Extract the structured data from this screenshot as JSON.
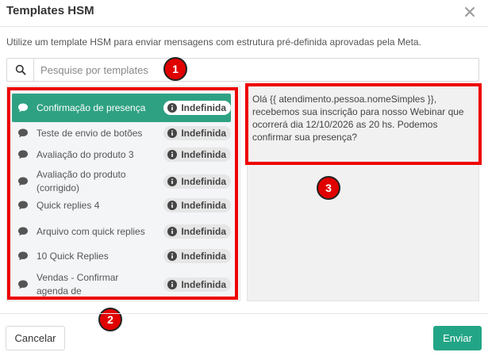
{
  "dialog": {
    "title": "Templates HSM",
    "description": "Utilize um template HSM para enviar mensagens com estrutura pré-definida aprovadas pela Meta."
  },
  "search": {
    "placeholder": "Pesquise por templates",
    "value": ""
  },
  "templates": [
    {
      "label": "Confirmação de presença",
      "badge": "Indefinida",
      "selected": true
    },
    {
      "label": "Teste de envio de botões",
      "badge": "Indefinida",
      "selected": false
    },
    {
      "label": "Avaliação do produto 3",
      "badge": "Indefinida",
      "selected": false
    },
    {
      "label": "Avaliação do produto (corrigido)",
      "badge": "Indefinida",
      "selected": false
    },
    {
      "label": "Quick replies 4",
      "badge": "Indefinida",
      "selected": false
    },
    {
      "label": "Arquivo com quick replies",
      "badge": "Indefinida",
      "selected": false
    },
    {
      "label": "10 Quick Replies",
      "badge": "Indefinida",
      "selected": false
    },
    {
      "label": "Vendas - Confirmar agenda de",
      "badge": "Indefinida",
      "selected": false
    }
  ],
  "preview": {
    "text": "Olá {{ atendimento.pessoa.nomeSimples }}, recebemos sua inscrição para nosso Webinar que ocorrerá dia 12/10/2026 as 20 hs. Podemos confirmar sua presença?"
  },
  "markers": [
    "1",
    "2",
    "3"
  ],
  "footer": {
    "cancel_label": "Cancelar",
    "send_label": "Enviar"
  },
  "colors": {
    "accent": "#22a586",
    "selected_bg": "#2fa183",
    "highlight": "#ee0000"
  },
  "icons": {
    "search": "search-icon",
    "close": "close-icon",
    "chat": "chat-bubble-icon",
    "info": "info-icon"
  }
}
